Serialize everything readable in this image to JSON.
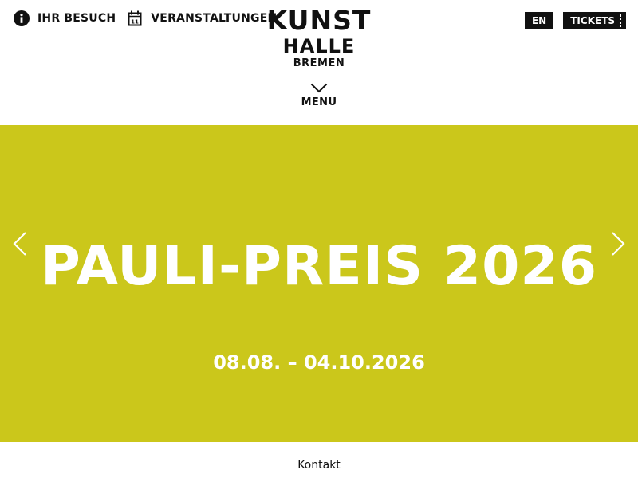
{
  "header": {
    "nav_left": [
      {
        "label": "IHR BESUCH",
        "icon": "info-icon"
      },
      {
        "label": "VERANSTALTUNGEN",
        "icon": "calendar-icon",
        "icon_text": "11"
      }
    ],
    "logo": {
      "line1": "KUNST",
      "line2": "HALLE",
      "line3": "BREMEN"
    },
    "menu_label": "MENU",
    "lang_label": "EN",
    "tickets_label": "TICKETS"
  },
  "hero": {
    "title": "PAULI-PREIS 2026",
    "dates": "08.08. – 04.10.2026",
    "background_color": "#cbc71b",
    "prev_icon": "chevron-left-icon",
    "next_icon": "chevron-right-icon"
  },
  "footer": {
    "link_label": "Kontakt"
  }
}
